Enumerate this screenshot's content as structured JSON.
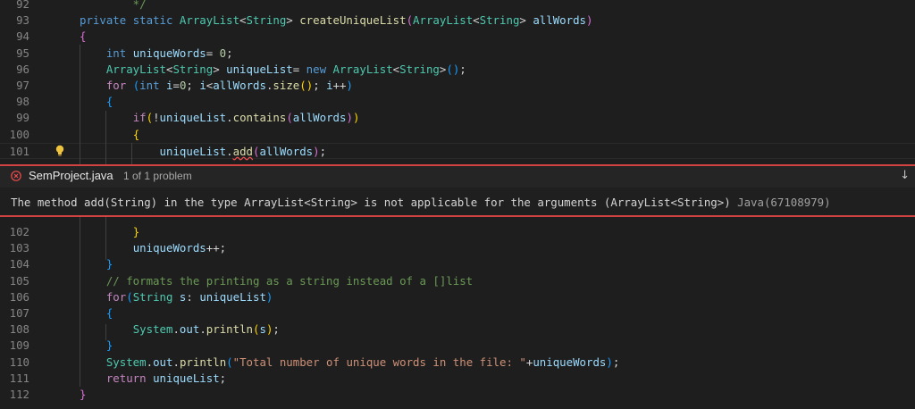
{
  "editor": {
    "lines_top": [
      {
        "num": "92",
        "tokens": [
          {
            "c": "t-cm",
            "t": "        */"
          }
        ]
      },
      {
        "num": "93",
        "tokens": [
          {
            "c": "t-kw",
            "t": "private "
          },
          {
            "c": "t-kw",
            "t": "static "
          },
          {
            "c": "t-ty",
            "t": "ArrayList"
          },
          {
            "c": "t-p",
            "t": "<"
          },
          {
            "c": "t-ty",
            "t": "String"
          },
          {
            "c": "t-p",
            "t": "> "
          },
          {
            "c": "t-fn",
            "t": "createUniqueList"
          },
          {
            "c": "t-b2",
            "t": "("
          },
          {
            "c": "t-ty",
            "t": "ArrayList"
          },
          {
            "c": "t-p",
            "t": "<"
          },
          {
            "c": "t-ty",
            "t": "String"
          },
          {
            "c": "t-p",
            "t": "> "
          },
          {
            "c": "t-var",
            "t": "allWords"
          },
          {
            "c": "t-b2",
            "t": ")"
          }
        ]
      },
      {
        "num": "94",
        "tokens": [
          {
            "c": "t-b2",
            "t": "{"
          }
        ]
      },
      {
        "num": "95",
        "tokens": [
          {
            "c": "t-p",
            "t": "    "
          },
          {
            "c": "t-kw",
            "t": "int "
          },
          {
            "c": "t-var",
            "t": "uniqueWords"
          },
          {
            "c": "t-p",
            "t": "= "
          },
          {
            "c": "t-num",
            "t": "0"
          },
          {
            "c": "t-p",
            "t": ";"
          }
        ]
      },
      {
        "num": "96",
        "tokens": [
          {
            "c": "t-p",
            "t": "    "
          },
          {
            "c": "t-ty",
            "t": "ArrayList"
          },
          {
            "c": "t-p",
            "t": "<"
          },
          {
            "c": "t-ty",
            "t": "String"
          },
          {
            "c": "t-p",
            "t": "> "
          },
          {
            "c": "t-var",
            "t": "uniqueList"
          },
          {
            "c": "t-p",
            "t": "= "
          },
          {
            "c": "t-kw",
            "t": "new "
          },
          {
            "c": "t-ty",
            "t": "ArrayList"
          },
          {
            "c": "t-p",
            "t": "<"
          },
          {
            "c": "t-ty",
            "t": "String"
          },
          {
            "c": "t-p",
            "t": ">"
          },
          {
            "c": "t-b3",
            "t": "()"
          },
          {
            "c": "t-p",
            "t": ";"
          }
        ]
      },
      {
        "num": "97",
        "tokens": [
          {
            "c": "t-p",
            "t": "    "
          },
          {
            "c": "t-ctl",
            "t": "for "
          },
          {
            "c": "t-b3",
            "t": "("
          },
          {
            "c": "t-kw",
            "t": "int "
          },
          {
            "c": "t-var",
            "t": "i"
          },
          {
            "c": "t-p",
            "t": "="
          },
          {
            "c": "t-num",
            "t": "0"
          },
          {
            "c": "t-p",
            "t": "; "
          },
          {
            "c": "t-var",
            "t": "i"
          },
          {
            "c": "t-p",
            "t": "<"
          },
          {
            "c": "t-var",
            "t": "allWords"
          },
          {
            "c": "t-p",
            "t": "."
          },
          {
            "c": "t-fn",
            "t": "size"
          },
          {
            "c": "t-b1",
            "t": "()"
          },
          {
            "c": "t-p",
            "t": "; "
          },
          {
            "c": "t-var",
            "t": "i"
          },
          {
            "c": "t-p",
            "t": "++"
          },
          {
            "c": "t-b3",
            "t": ")"
          }
        ]
      },
      {
        "num": "98",
        "tokens": [
          {
            "c": "t-p",
            "t": "    "
          },
          {
            "c": "t-b3",
            "t": "{"
          }
        ]
      },
      {
        "num": "99",
        "tokens": [
          {
            "c": "t-p",
            "t": "        "
          },
          {
            "c": "t-ctl",
            "t": "if"
          },
          {
            "c": "t-b1",
            "t": "("
          },
          {
            "c": "t-p",
            "t": "!"
          },
          {
            "c": "t-var",
            "t": "uniqueList"
          },
          {
            "c": "t-p",
            "t": "."
          },
          {
            "c": "t-fn",
            "t": "contains"
          },
          {
            "c": "t-b2",
            "t": "("
          },
          {
            "c": "t-var",
            "t": "allWords"
          },
          {
            "c": "t-b2",
            "t": ")"
          },
          {
            "c": "t-b1",
            "t": ")"
          }
        ]
      },
      {
        "num": "100",
        "tokens": [
          {
            "c": "t-p",
            "t": "        "
          },
          {
            "c": "t-b1",
            "t": "{"
          }
        ]
      },
      {
        "num": "101",
        "tokens": [
          {
            "c": "t-p",
            "t": "            "
          },
          {
            "c": "t-var",
            "t": "uniqueList"
          },
          {
            "c": "t-p",
            "t": "."
          },
          {
            "c": "t-fn squiggle",
            "t": "add"
          },
          {
            "c": "t-b2",
            "t": "("
          },
          {
            "c": "t-var",
            "t": "allWords"
          },
          {
            "c": "t-b2",
            "t": ")"
          },
          {
            "c": "t-p",
            "t": ";"
          }
        ]
      }
    ],
    "lines_bottom": [
      {
        "num": "102",
        "tokens": [
          {
            "c": "t-p",
            "t": "        "
          },
          {
            "c": "t-b1",
            "t": "}"
          }
        ]
      },
      {
        "num": "103",
        "tokens": [
          {
            "c": "t-p",
            "t": "        "
          },
          {
            "c": "t-var",
            "t": "uniqueWords"
          },
          {
            "c": "t-p",
            "t": "++;"
          }
        ]
      },
      {
        "num": "104",
        "tokens": [
          {
            "c": "t-p",
            "t": "    "
          },
          {
            "c": "t-b3",
            "t": "}"
          }
        ]
      },
      {
        "num": "105",
        "tokens": [
          {
            "c": "t-p",
            "t": "    "
          },
          {
            "c": "t-cm",
            "t": "// formats the printing as a string instead of a []list"
          }
        ]
      },
      {
        "num": "106",
        "tokens": [
          {
            "c": "t-p",
            "t": "    "
          },
          {
            "c": "t-ctl",
            "t": "for"
          },
          {
            "c": "t-b3",
            "t": "("
          },
          {
            "c": "t-ty",
            "t": "String "
          },
          {
            "c": "t-var",
            "t": "s"
          },
          {
            "c": "t-p",
            "t": ": "
          },
          {
            "c": "t-var",
            "t": "uniqueList"
          },
          {
            "c": "t-b3",
            "t": ")"
          }
        ]
      },
      {
        "num": "107",
        "tokens": [
          {
            "c": "t-p",
            "t": "    "
          },
          {
            "c": "t-b3",
            "t": "{"
          }
        ]
      },
      {
        "num": "108",
        "tokens": [
          {
            "c": "t-p",
            "t": "        "
          },
          {
            "c": "t-ty",
            "t": "System"
          },
          {
            "c": "t-p",
            "t": "."
          },
          {
            "c": "t-var",
            "t": "out"
          },
          {
            "c": "t-p",
            "t": "."
          },
          {
            "c": "t-fn",
            "t": "println"
          },
          {
            "c": "t-b1",
            "t": "("
          },
          {
            "c": "t-var",
            "t": "s"
          },
          {
            "c": "t-b1",
            "t": ")"
          },
          {
            "c": "t-p",
            "t": ";"
          }
        ]
      },
      {
        "num": "109",
        "tokens": [
          {
            "c": "t-p",
            "t": "    "
          },
          {
            "c": "t-b3",
            "t": "}"
          }
        ]
      },
      {
        "num": "110",
        "tokens": [
          {
            "c": "t-p",
            "t": "    "
          },
          {
            "c": "t-ty",
            "t": "System"
          },
          {
            "c": "t-p",
            "t": "."
          },
          {
            "c": "t-var",
            "t": "out"
          },
          {
            "c": "t-p",
            "t": "."
          },
          {
            "c": "t-fn",
            "t": "println"
          },
          {
            "c": "t-b3",
            "t": "("
          },
          {
            "c": "t-str",
            "t": "\"Total number of unique words in the file: \""
          },
          {
            "c": "t-p",
            "t": "+"
          },
          {
            "c": "t-var",
            "t": "uniqueWords"
          },
          {
            "c": "t-b3",
            "t": ")"
          },
          {
            "c": "t-p",
            "t": ";"
          }
        ]
      },
      {
        "num": "111",
        "tokens": [
          {
            "c": "t-p",
            "t": "    "
          },
          {
            "c": "t-ctl",
            "t": "return "
          },
          {
            "c": "t-var",
            "t": "uniqueList"
          },
          {
            "c": "t-p",
            "t": ";"
          }
        ]
      },
      {
        "num": "112",
        "tokens": [
          {
            "c": "t-b2",
            "t": "}"
          }
        ]
      }
    ]
  },
  "problem_peek": {
    "file_name": "SemProject.java",
    "count_text": "1 of 1 problem",
    "next_arrow": "↓",
    "message": "The method add(String) in the type ArrayList<String> is not applicable for the arguments (ArrayList<String>) ",
    "source_code": "Java(67108979)"
  },
  "colors": {
    "error": "#d14343",
    "bulb": "#f0c33c"
  }
}
